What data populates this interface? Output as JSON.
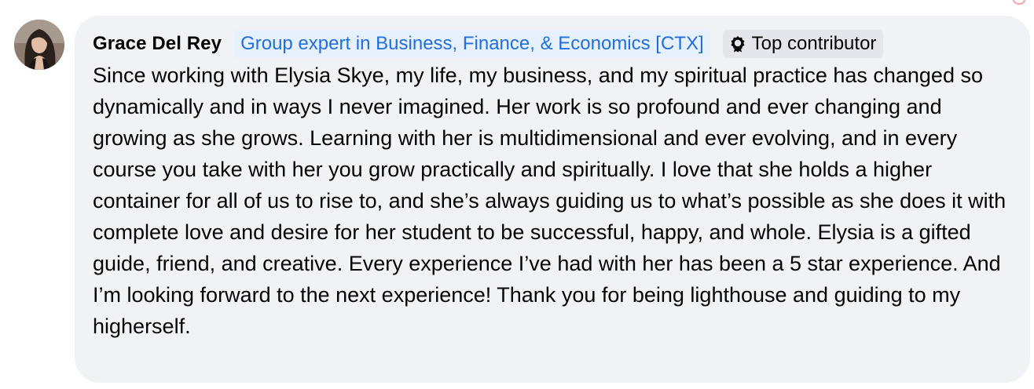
{
  "comment": {
    "author": "Grace Del Rey",
    "expert_badge": "Group expert in Business, Finance, & Economics [CTX]",
    "contributor_badge": "Top contributor",
    "contributor_icon": "award-badge-icon",
    "avatar_icon": "profile-photo",
    "text": "Since working with Elysia Skye, my life, my business, and my spiritual practice has changed so dynamically and in ways I never imagined. Her work is so profound and ever changing and growing as she grows. Learning with her is multidimensional and ever evolving, and in every course you take with her you grow practically and spiritually. I love that she holds a higher container for all of us to rise to, and she’s always guiding us to what’s possible as she does it with complete love and desire for her student to be successful, happy, and whole. Elysia is a gifted guide, friend, and creative. Every experience I’ve had with her has been a 5 star experience. And I’m looking forward to the next experience! Thank you for being lighthouse and guiding to my higherself."
  },
  "colors": {
    "bubble_bg": "#f0f2f5",
    "expert_text": "#216fdb",
    "expert_bg": "#e7f0fd",
    "contributor_bg": "#e4e6eb",
    "text": "#050505"
  }
}
